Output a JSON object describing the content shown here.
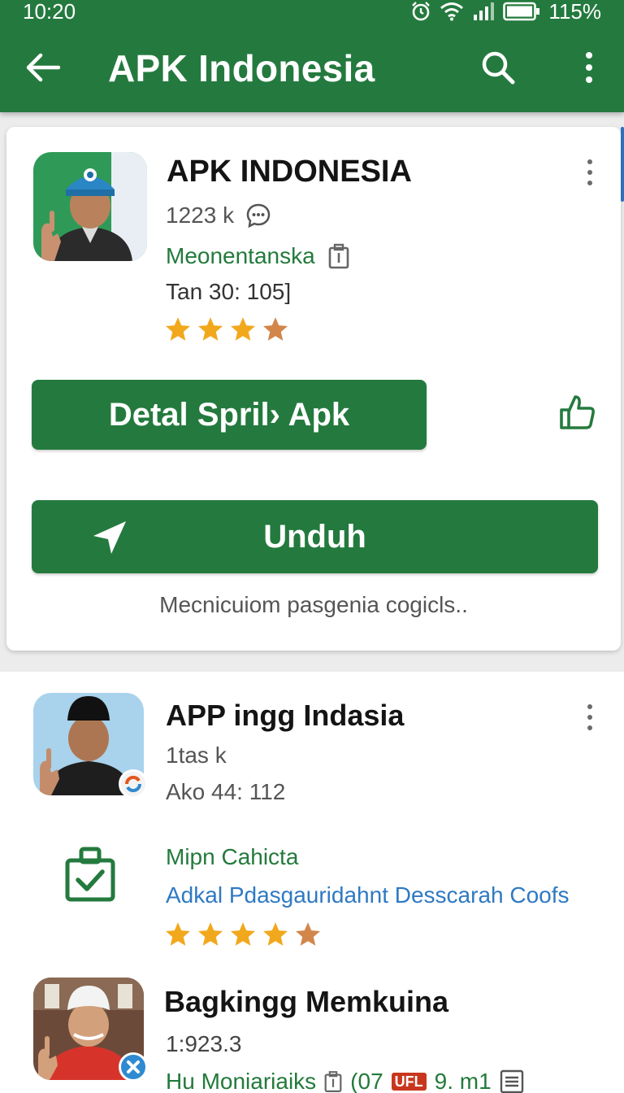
{
  "status_bar": {
    "time": "10:20",
    "battery": "115%"
  },
  "toolbar": {
    "title": "APK Indonesia",
    "icons": [
      "back-arrow-icon",
      "search-icon",
      "more-vert-icon"
    ]
  },
  "featured": {
    "title": "APK INDONESIA",
    "count": "1223 k",
    "developer": "Meonentanska",
    "date": "Tan  30: 105]",
    "rating": 4,
    "rating_max": 4,
    "detail_button": "Detal Spril› Apk",
    "download_button": "Unduh",
    "footer_text": "Mecnicuiom  pasgenia  cogicls.."
  },
  "list": [
    {
      "title": "APP ingg Indasia",
      "count": "1tas  k",
      "date": "Ako  44: 112",
      "developer": "Mipn Cahicta",
      "description": "Adkal Pdasgauridahnt Desscarah Coofs",
      "rating": 5
    },
    {
      "title": "Bagkingg Memkuina",
      "count": "1:923.3",
      "developer_line": "Hu Moniariaiks",
      "extra_prefix": "(07",
      "tag": "UFL",
      "extra_suffix": "9.  m1"
    }
  ],
  "colors": {
    "primary": "#247a3e",
    "star_gold": "#f2a81d",
    "star_bronze": "#d2864a",
    "link_blue": "#2f79c2"
  }
}
